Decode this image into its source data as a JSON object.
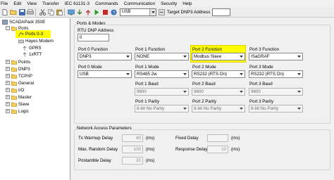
{
  "menu": [
    "File",
    "Edit",
    "View",
    "Transfer",
    "IEC 61131-3",
    "Commands",
    "Communication",
    "Security",
    "Help"
  ],
  "toolbar": {
    "connection": "USB",
    "target_label": "Target DNP3 Address",
    "target_value": ""
  },
  "tree": {
    "root": "SCADAPack 350E",
    "ports": "Ports",
    "ports_0_3": "Ports 0-3",
    "hayes": "Hayes Modem",
    "gprs": "GPRS",
    "rtt": "1xRTT",
    "points": "Points",
    "dnp3": "DNP3",
    "tcpip": "TCP/IP",
    "general": "General",
    "io": "I/O",
    "master": "Master",
    "slave": "Slave",
    "logic": "Logic"
  },
  "ports_modes": {
    "title": "Ports & Modes",
    "rtu_label": "RTU DNP Address",
    "rtu_value": "0",
    "function_labels": [
      "Port 0 Function",
      "Port 1 Function",
      "Port 2 Function",
      "Port 3 Function"
    ],
    "function_values": [
      "DNP3",
      "NONE",
      "Modbus Slave",
      "ISaGRAF"
    ],
    "mode_labels": [
      "Port 0 Mode",
      "Port 1 Mode",
      "Port 2 Mode",
      "Port 3 Mode"
    ],
    "mode_values": [
      "USB",
      "RS485 2w",
      "RS232 (RTS On)",
      "RS232 (RTS On)"
    ],
    "baud_labels": [
      "Port 1 Baud",
      "Port 2 Baud",
      "Port 3 Baud"
    ],
    "baud_values": [
      "9600",
      "9600",
      "9600"
    ],
    "parity_labels": [
      "Port 1 Parity",
      "Port 2 Parity",
      "Port 3 Parity"
    ],
    "parity_values": [
      "8-bit No Parity",
      "8-bit No Parity",
      "8-bit No Parity"
    ]
  },
  "network": {
    "title": "Network Access Parameters",
    "tx_warmup_label": "Tx Warmup Delay",
    "tx_warmup_value": "60",
    "max_random_label": "Max. Random Delay",
    "max_random_value": "100",
    "postamble_label": "Postamble Delay",
    "postamble_value": "20",
    "fixed_label": "Fixed Delay",
    "response_label": "Response Delay",
    "response_value": "10",
    "unit": "(ms)"
  },
  "colors": {
    "highlight": "#ffff00"
  }
}
